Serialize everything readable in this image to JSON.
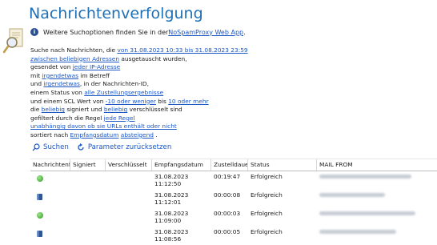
{
  "page": {
    "title": "Nachrichtenverfolgung",
    "info_prefix": "Weitere Suchoptionen finden Sie in der ",
    "info_link": "NoSpamProxy Web App",
    "info_suffix": " ."
  },
  "query": {
    "l1_a": "Suche nach Nachrichten, die ",
    "l1_link": "von 31.08.2023 10:33 bis 31.08.2023 23:59",
    "l2_link": "zwischen beliebigen Adressen",
    "l2_b": " ausgetauscht wurden,",
    "l3_a": "gesendet von ",
    "l3_link": "jeder IP-Adresse",
    "l4_a": "mit ",
    "l4_link": "irgendetwas",
    "l4_b": " im Betreff",
    "l5_a": "und ",
    "l5_link": "irgendetwas",
    "l5_b": ", in der Nachrichten-ID,",
    "l6_a": "einem Status von ",
    "l6_link": "alle Zustellungsergebnisse",
    "l7_a": "und einem SCL Wert von ",
    "l7_link1": "-10 oder weniger",
    "l7_b": " bis ",
    "l7_link2": "10 oder mehr",
    "l8_a": "die ",
    "l8_link1": "beliebig",
    "l8_b": " signiert und ",
    "l8_link2": "beliebig",
    "l8_c": " verschlüsselt sind",
    "l9_a": "gefiltert durch die Regel ",
    "l9_link": "jede Regel",
    "l10_link": "unabhängig davon ob sie URLs enthält oder nicht",
    "l11_a": "sortiert nach ",
    "l11_link1": "Empfangsdatum",
    "l11_link2": "absteigend",
    "l11_b": " ."
  },
  "actions": {
    "search": "Suchen",
    "reset": "Parameter zurücksetzen"
  },
  "table": {
    "columns": [
      "Nachrichtenfluss",
      "Signiert",
      "Verschlüsselt",
      "Empfangsdatum",
      "Zustelldauer",
      "Status",
      "MAIL FROM"
    ],
    "rows": [
      {
        "flow_icon": "inbound-ok-icon",
        "date": "31.08.2023",
        "time": "11:12:50",
        "duration": "00:19:47",
        "status": "Erfolgreich"
      },
      {
        "flow_icon": "server-icon",
        "date": "31.08.2023",
        "time": "11:12:01",
        "duration": "00:00:08",
        "status": "Erfolgreich"
      },
      {
        "flow_icon": "inbound-ok-icon",
        "date": "31.08.2023",
        "time": "11:09:00",
        "duration": "00:00:03",
        "status": "Erfolgreich"
      },
      {
        "flow_icon": "server-icon",
        "date": "31.08.2023",
        "time": "11:08:56",
        "duration": "00:00:05",
        "status": "Erfolgreich"
      }
    ]
  },
  "colors": {
    "title": "#1f6fb5",
    "link": "#1a56c4"
  }
}
